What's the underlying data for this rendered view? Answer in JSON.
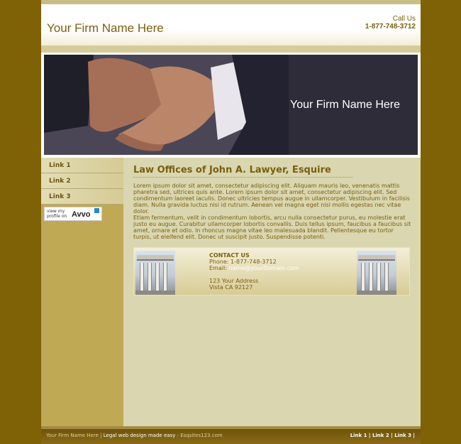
{
  "header": {
    "title": "Your Firm Name Here",
    "call_label": "Call Us",
    "phone": "1-877-748-3712"
  },
  "banner": {
    "title": "Your Firm Name Here"
  },
  "sidebar": {
    "links": [
      {
        "label": "Link 1"
      },
      {
        "label": "Link 2"
      },
      {
        "label": "Link 3"
      }
    ],
    "avvo": {
      "small_text": "view my profile on",
      "logo": "Avvo"
    }
  },
  "main": {
    "heading": "Law Offices of John A. Lawyer, Esquire",
    "paragraph1": "Lorem ipsum dolor sit amet, consectetur adipiscing elit. Aliquam mauris leo, venenatis mattis pharetra sed, ultrices quis ante. Lorem ipsum dolor sit amet, consectetur adipiscing elit. Sed condimentum laoreet iaculis. Donec ultricies tempus augue in ullamcorper. Vestibulum in facilisis diam. Nulla gravida luctus nisi id rutrum. Aenean vel magna eget nisl mollis egestas nec vitae dolor.",
    "paragraph2": "Etiam fermentum, velit in condimentum lobortis, arcu nulla consectetur purus, eu molestie erat justo eu augue. Curabitur ullamcorper lobortis convallis. Duis tellus ipsum, faucibus a faucibus sit amet, ornare et odio. In rhoncus magna vitae leo malesuada blandit. Pellentesque eu tortor turpis, ut eleifend elit. Donec ut suscipit justo. Suspendisse potenti."
  },
  "contact": {
    "heading": "CONTACT US",
    "phone_line": "Phone: 1-877-748-3712",
    "email_label": "Email: ",
    "email": "name@yourDomain.com",
    "address1": "123 Your Address",
    "address2": "Vista CA 92127"
  },
  "footer": {
    "firm": "Your Firm Name Here",
    "sep": " | ",
    "tagline": "Legal web design made easy",
    "dash": " - ",
    "credit": "Esqsites123.com",
    "links": [
      "Link 1",
      "Link 2",
      "Link 3"
    ]
  },
  "colors": {
    "outer_background": "#7f6206",
    "accent_text": "#7a5f0e",
    "content_background": "#d9d6b0"
  }
}
